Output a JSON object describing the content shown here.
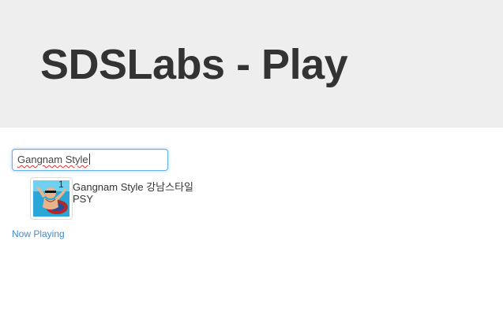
{
  "header": {
    "title": "SDSLabs - Play"
  },
  "search": {
    "value": "Gangnam Style"
  },
  "results": [
    {
      "number": "1",
      "title": "Gangnam Style 강남스타일",
      "artist": "PSY",
      "thumb_icon": "album-art-psy"
    }
  ],
  "links": {
    "now_playing": "Now Playing"
  },
  "colors": {
    "hero_bg": "#eeeeee",
    "link": "#428bca",
    "focus_border": "#66afe9"
  }
}
